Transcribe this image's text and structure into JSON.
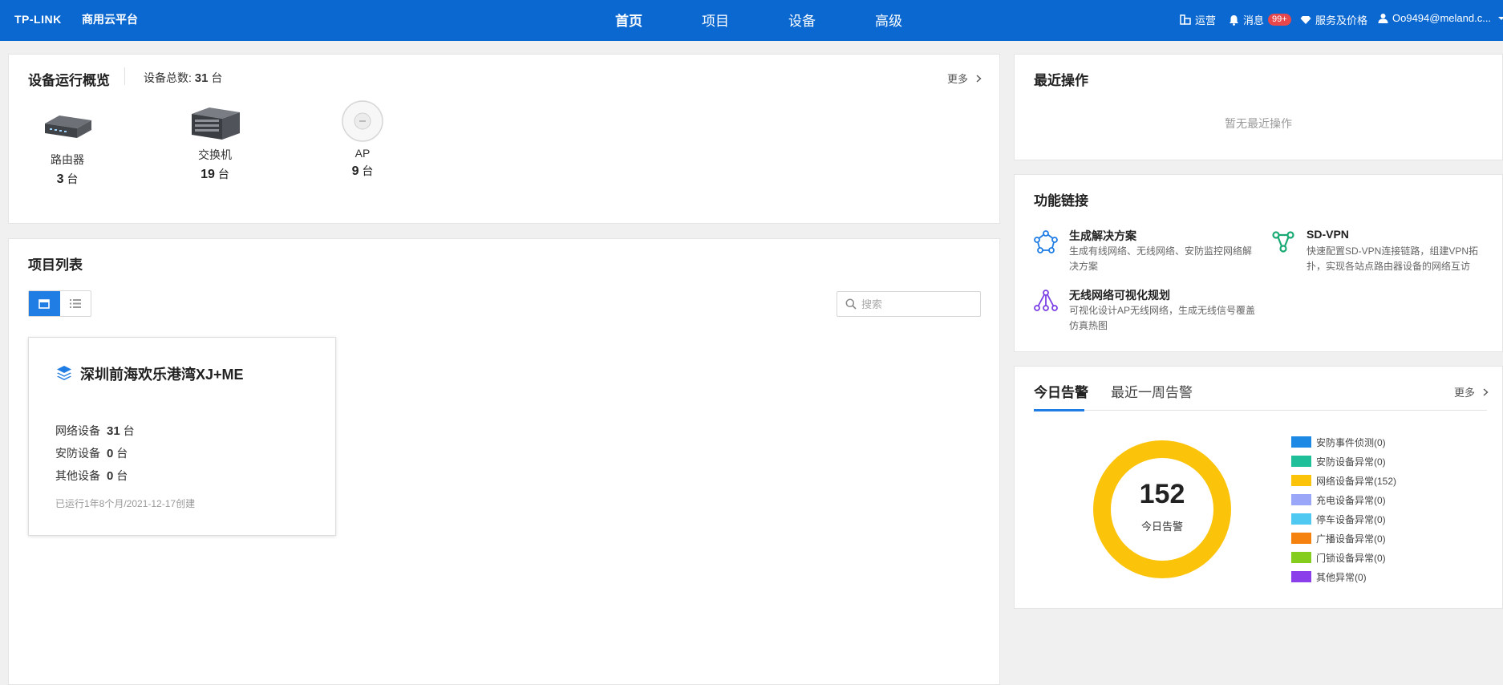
{
  "header": {
    "logo": "TP-LINK",
    "platform": "商用云平台",
    "nav": [
      {
        "label": "首页",
        "active": true
      },
      {
        "label": "项目",
        "active": false
      },
      {
        "label": "设备",
        "active": false
      },
      {
        "label": "高级",
        "active": false
      }
    ],
    "operations": "运营",
    "messages": "消息",
    "messages_badge": "99+",
    "services": "服务及价格",
    "user": "Oo9494@meland.c..."
  },
  "overview": {
    "title": "设备运行概览",
    "total_label": "设备总数:",
    "total_value": "31",
    "unit": "台",
    "more": "更多",
    "devices": [
      {
        "name": "路由器",
        "count": "3",
        "icon": "router-icon"
      },
      {
        "name": "交换机",
        "count": "19",
        "icon": "switch-icon"
      },
      {
        "name": "AP",
        "count": "9",
        "icon": "access-point-icon"
      }
    ]
  },
  "projects": {
    "title": "项目列表",
    "search_placeholder": "搜索",
    "cards": [
      {
        "name": "深圳前海欢乐港湾XJ+ME",
        "stats": [
          {
            "label": "网络设备",
            "value": "31",
            "unit": "台"
          },
          {
            "label": "安防设备",
            "value": "0",
            "unit": "台"
          },
          {
            "label": "其他设备",
            "value": "0",
            "unit": "台"
          }
        ],
        "created": "已运行1年8个月/2021-12-17创建"
      }
    ]
  },
  "recent": {
    "title": "最近操作",
    "empty": "暂无最近操作"
  },
  "features": {
    "title": "功能链接",
    "items": [
      {
        "title": "生成解决方案",
        "desc": "生成有线网络、无线网络、安防监控网络解决方案",
        "icon": "solution-network-icon",
        "color": "#1f7de4"
      },
      {
        "title": "SD-VPN",
        "desc": "快速配置SD-VPN连接链路，组建VPN拓扑，实现各站点路由器设备的网络互访",
        "icon": "vpn-topology-icon",
        "color": "#19a974"
      },
      {
        "title": "无线网络可视化规划",
        "desc": "可视化设计AP无线网络，生成无线信号覆盖仿真热图",
        "icon": "wireless-planning-icon",
        "color": "#7b3fe4"
      }
    ]
  },
  "alarms": {
    "tabs": [
      "今日告警",
      "最近一周告警"
    ],
    "active_tab": 0,
    "more": "更多",
    "total": "152",
    "total_label": "今日告警",
    "legend": [
      {
        "label": "安防事件侦测(0)",
        "value": 0,
        "color": "#1e88e5"
      },
      {
        "label": "安防设备异常(0)",
        "value": 0,
        "color": "#1fbf9a"
      },
      {
        "label": "网络设备异常(152)",
        "value": 152,
        "color": "#fbc30a"
      },
      {
        "label": "充电设备异常(0)",
        "value": 0,
        "color": "#9aa7f8"
      },
      {
        "label": "停车设备异常(0)",
        "value": 0,
        "color": "#4fc8f2"
      },
      {
        "label": "广播设备异常(0)",
        "value": 0,
        "color": "#f5810f"
      },
      {
        "label": "门锁设备异常(0)",
        "value": 0,
        "color": "#84cc1d"
      },
      {
        "label": "其他异常(0)",
        "value": 0,
        "color": "#8b3fea"
      }
    ]
  }
}
